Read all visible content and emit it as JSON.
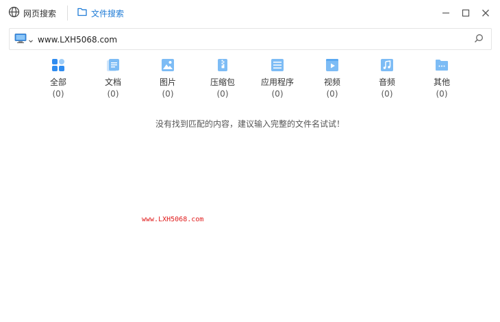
{
  "tabs": {
    "web_search": {
      "label": "网页搜索",
      "icon": "globe-icon"
    },
    "file_search": {
      "label": "文件搜索",
      "icon": "folder-icon",
      "active": true
    }
  },
  "window_controls": {
    "minimize": "minimize-icon",
    "maximize": "maximize-icon",
    "close": "close-icon"
  },
  "search": {
    "scope_icon": "computer-icon",
    "value": "www.LXH5068.com",
    "placeholder": ""
  },
  "categories": [
    {
      "name": "全部",
      "count": "(0)",
      "icon": "grid-icon"
    },
    {
      "name": "文档",
      "count": "(0)",
      "icon": "document-icon"
    },
    {
      "name": "图片",
      "count": "(0)",
      "icon": "image-icon"
    },
    {
      "name": "压缩包",
      "count": "(0)",
      "icon": "archive-icon"
    },
    {
      "name": "应用程序",
      "count": "(0)",
      "icon": "application-icon"
    },
    {
      "name": "视频",
      "count": "(0)",
      "icon": "video-icon"
    },
    {
      "name": "音频",
      "count": "(0)",
      "icon": "music-icon"
    },
    {
      "name": "其他",
      "count": "(0)",
      "icon": "folder-more-icon"
    }
  ],
  "empty_message": "没有找到匹配的内容，建议输入完整的文件名试试！",
  "watermark": "www.LXH5068.com",
  "colors": {
    "accent": "#1e7bd6",
    "icon_blue": "#5aa9f2",
    "icon_light": "#9dccf7",
    "watermark": "#e01a1a"
  }
}
